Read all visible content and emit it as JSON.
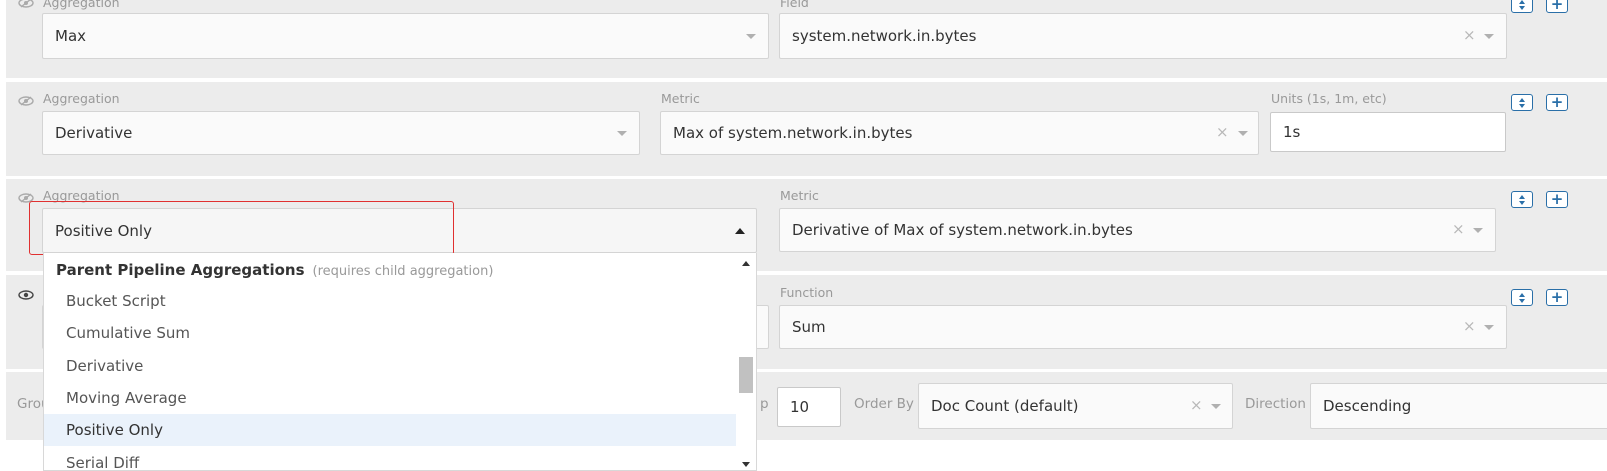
{
  "rows": [
    {
      "aggregation_label": "Aggregation",
      "aggregation_value": "Max",
      "field_label": "Field",
      "field_value": "system.network.in.bytes"
    },
    {
      "aggregation_label": "Aggregation",
      "aggregation_value": "Derivative",
      "metric_label": "Metric",
      "metric_value": "Max of system.network.in.bytes",
      "units_label": "Units (1s, 1m, etc)",
      "units_value": "1s"
    },
    {
      "aggregation_label": "Aggregation",
      "aggregation_value": "Positive Only",
      "metric_label": "Metric",
      "metric_value": "Derivative of Max of system.network.in.bytes"
    },
    {
      "function_label": "Function",
      "function_value": "Sum"
    }
  ],
  "group_row": {
    "group_label_partial": "Grou",
    "top_label_partial": "p",
    "top_value": "10",
    "order_by_label": "Order By",
    "order_by_value": "Doc Count (default)",
    "direction_label": "Direction",
    "direction_value": "Descending"
  },
  "dropdown": {
    "group_header": "Parent Pipeline Aggregations",
    "group_note": "(requires child aggregation)",
    "options": [
      "Bucket Script",
      "Cumulative Sum",
      "Derivative",
      "Moving Average",
      "Positive Only",
      "Serial Diff"
    ],
    "highlighted": "Positive Only"
  },
  "icons": {
    "visibility": "eye-icon",
    "visibility_hidden": "eye-slash-icon",
    "sort": "sort-icon",
    "add": "plus-icon",
    "clear": "clear-x-icon",
    "caret": "caret-down-icon"
  },
  "colors": {
    "accent": "#2a6fa8",
    "focus_outline": "#e03030",
    "highlight": "#eaf2fb",
    "row_bg": "#ececec"
  }
}
